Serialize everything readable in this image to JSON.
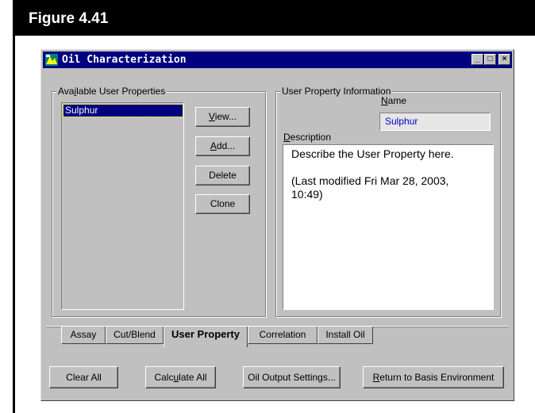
{
  "figure": {
    "label": "Figure 4.41"
  },
  "window": {
    "title": "Oil Characterization",
    "controls": {
      "minimize": "_",
      "maximize": "□",
      "close": "×"
    }
  },
  "available_group": {
    "label_pre": "Ava",
    "label_u": "i",
    "label_post": "lable User Properties",
    "items": [
      "Sulphur"
    ]
  },
  "buttons": {
    "view": {
      "u": "V",
      "rest": "iew..."
    },
    "add": {
      "u": "A",
      "rest": "dd..."
    },
    "delete": "Delete",
    "clone": "Clone"
  },
  "info_group": {
    "label": "User Property Information",
    "name_label_u": "N",
    "name_label_rest": "ame",
    "name_value": "Sulphur",
    "description_label_u": "D",
    "description_label_rest": "escription",
    "description_line1": "Describe the User Property here.",
    "description_line2": "(Last modified Fri Mar 28, 2003,",
    "description_line3": "10:49)"
  },
  "tabs": [
    {
      "label": "Assay",
      "active": false
    },
    {
      "label": "Cut/Blend",
      "active": false
    },
    {
      "label": "User Property",
      "active": true
    },
    {
      "label": "Correlation",
      "active": false
    },
    {
      "label": "Install Oil",
      "active": false
    }
  ],
  "bottom_buttons": {
    "clear_all": "Clear All",
    "calc_pre": "Calc",
    "calc_u": "u",
    "calc_post": "late All",
    "oil_output": "Oil Output Settings...",
    "return_u": "R",
    "return_rest": "eturn to Basis Environment"
  },
  "colors": {
    "titlebar": "#000080",
    "selection": "#000080",
    "field_text": "#0000cc",
    "window_bg": "#c0c0c0"
  }
}
